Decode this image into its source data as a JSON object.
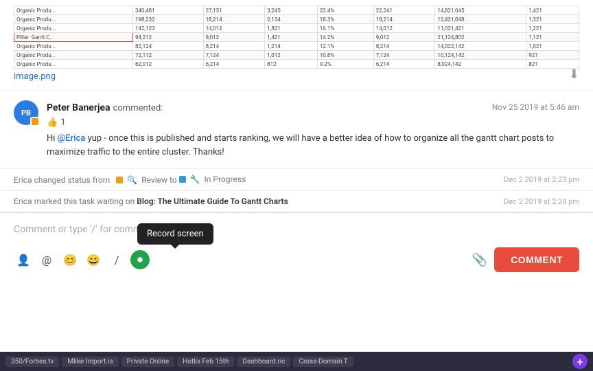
{
  "image": {
    "filename": "image.png",
    "download_tooltip": "Download"
  },
  "comment": {
    "author": "Peter Banerjea",
    "action": "commented:",
    "timestamp": "Nov 25 2019 at 5:46 am",
    "text_part1": "Hi ",
    "mention": "@Erica",
    "text_part2": " yup - once this is published and starts ranking, we will have a better idea of how to organize all the gantt chart posts to maximize traffic to the entire cluster. Thanks!",
    "likes": "1",
    "avatar_initials": "PB"
  },
  "activity1": {
    "text": "Erica changed status from",
    "from_status": "Review",
    "to_label": "to",
    "to_status": "In Progress",
    "timestamp": "Dec 2 2019 at 2:23 pm"
  },
  "activity2": {
    "text": "Erica marked this task waiting on",
    "link": "Blog: The Ultimate Guide To Gantt Charts",
    "timestamp": "Dec 2 2019 at 2:24 pm"
  },
  "comment_input": {
    "placeholder": "Comment or type '/' for commands"
  },
  "toolbar": {
    "icons": [
      {
        "name": "person-icon",
        "symbol": "👤"
      },
      {
        "name": "at-icon",
        "symbol": "@"
      },
      {
        "name": "emoji-icon",
        "symbol": "😊"
      },
      {
        "name": "smiley-icon",
        "symbol": "😄"
      },
      {
        "name": "slash-icon",
        "symbol": "/"
      },
      {
        "name": "record-icon",
        "symbol": "⏺"
      }
    ],
    "record_tooltip": "Record screen",
    "comment_button": "COMMENT",
    "attach_icon": "📎"
  },
  "taskbar": {
    "items": [
      "350/Forbes.tv",
      "Mlike Import.is",
      "Private Online",
      "Hotlix Feb 15th",
      "Dashboard.ric",
      "Cross-Domain T"
    ],
    "plus_label": "+"
  }
}
